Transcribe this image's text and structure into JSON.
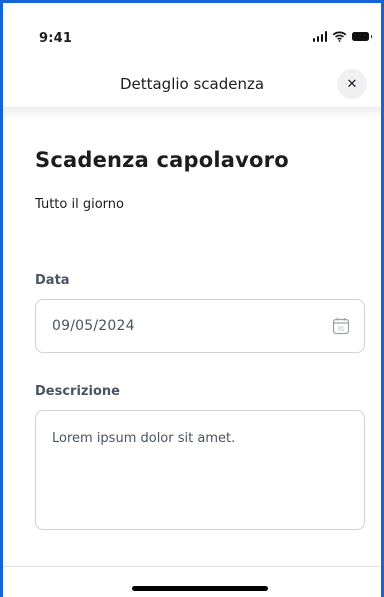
{
  "status_bar": {
    "time": "9:41",
    "signal_icon": "cellular-signal-icon",
    "wifi_icon": "wifi-icon",
    "battery_icon": "battery-icon"
  },
  "header": {
    "title": "Dettaglio scadenza",
    "close_symbol": "✕",
    "close_icon": "close-icon"
  },
  "main": {
    "title": "Scadenza capolavoro",
    "subtitle": "Tutto il giorno",
    "date_label": "Data",
    "date_value": "09/05/2024",
    "calendar_icon": "calendar-icon",
    "calendar_glyph": "31",
    "description_label": "Descrizione",
    "description_value": "Lorem ipsum dolor sit amet."
  },
  "colors": {
    "frame_border": "#1565d8",
    "label_text": "#4a5560",
    "field_border": "#cfd3d8",
    "close_button_bg": "#f0f0f2"
  }
}
